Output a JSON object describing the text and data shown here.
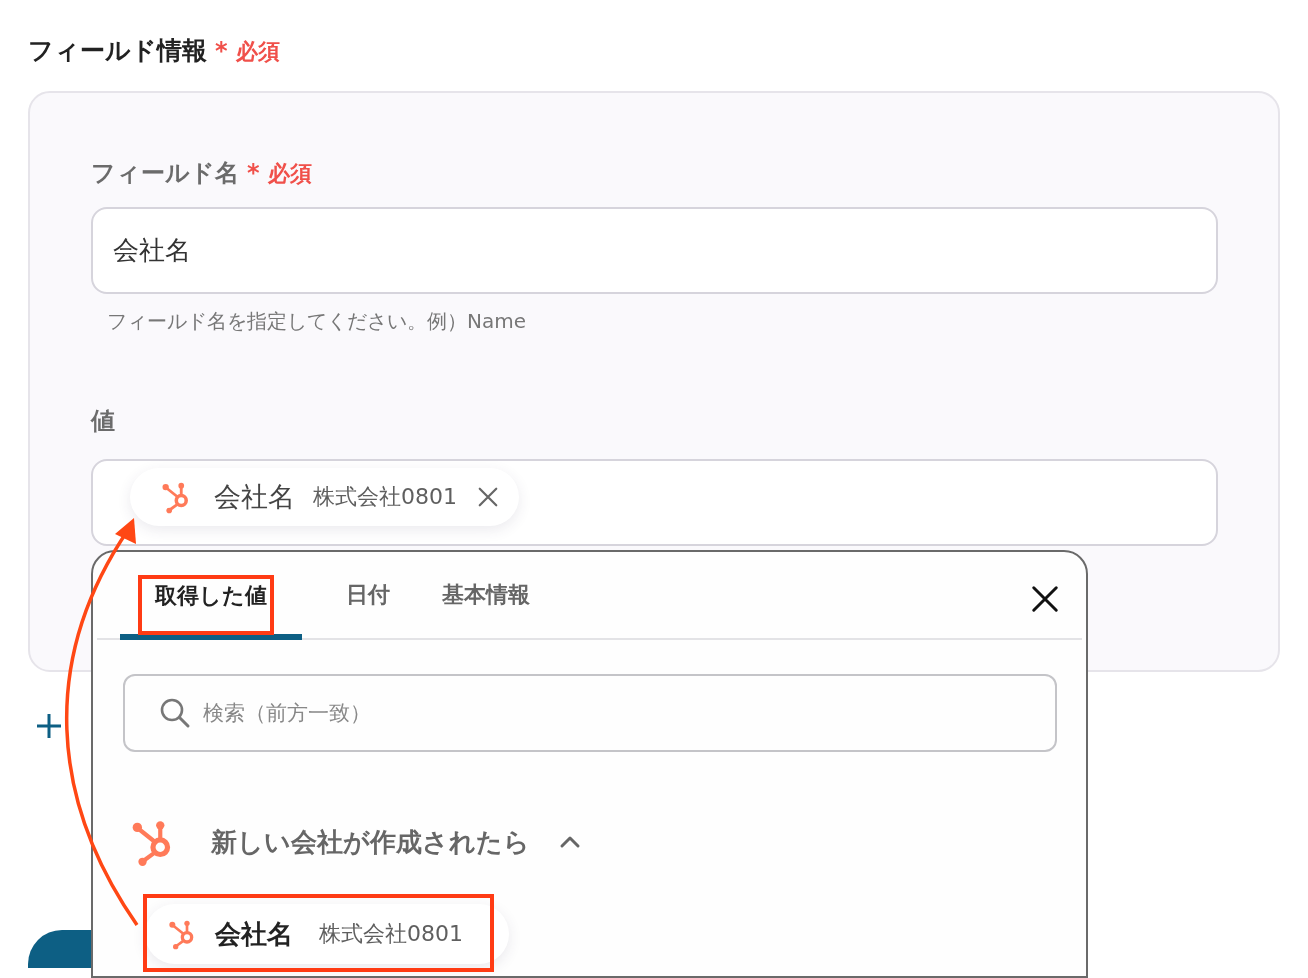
{
  "section": {
    "title": "フィールド情報",
    "required_mark": "*",
    "required_label": "必須"
  },
  "field_name": {
    "label": "フィールド名",
    "required_mark": "*",
    "required_label": "必須",
    "value": "会社名",
    "hint": "フィールド名を指定してください。例）Name"
  },
  "value_field": {
    "label": "値",
    "chip": {
      "name": "会社名",
      "value": "株式会社0801"
    }
  },
  "picker": {
    "tabs": [
      {
        "label": "取得した値",
        "selected": true
      },
      {
        "label": "日付",
        "selected": false
      },
      {
        "label": "基本情報",
        "selected": false
      }
    ],
    "search": {
      "placeholder": "検索（前方一致）"
    },
    "groups": [
      {
        "title": "新しい会社が作成されたら",
        "expanded": true,
        "items": [
          {
            "name": "会社名",
            "value": "株式会社0801"
          }
        ]
      }
    ]
  }
}
